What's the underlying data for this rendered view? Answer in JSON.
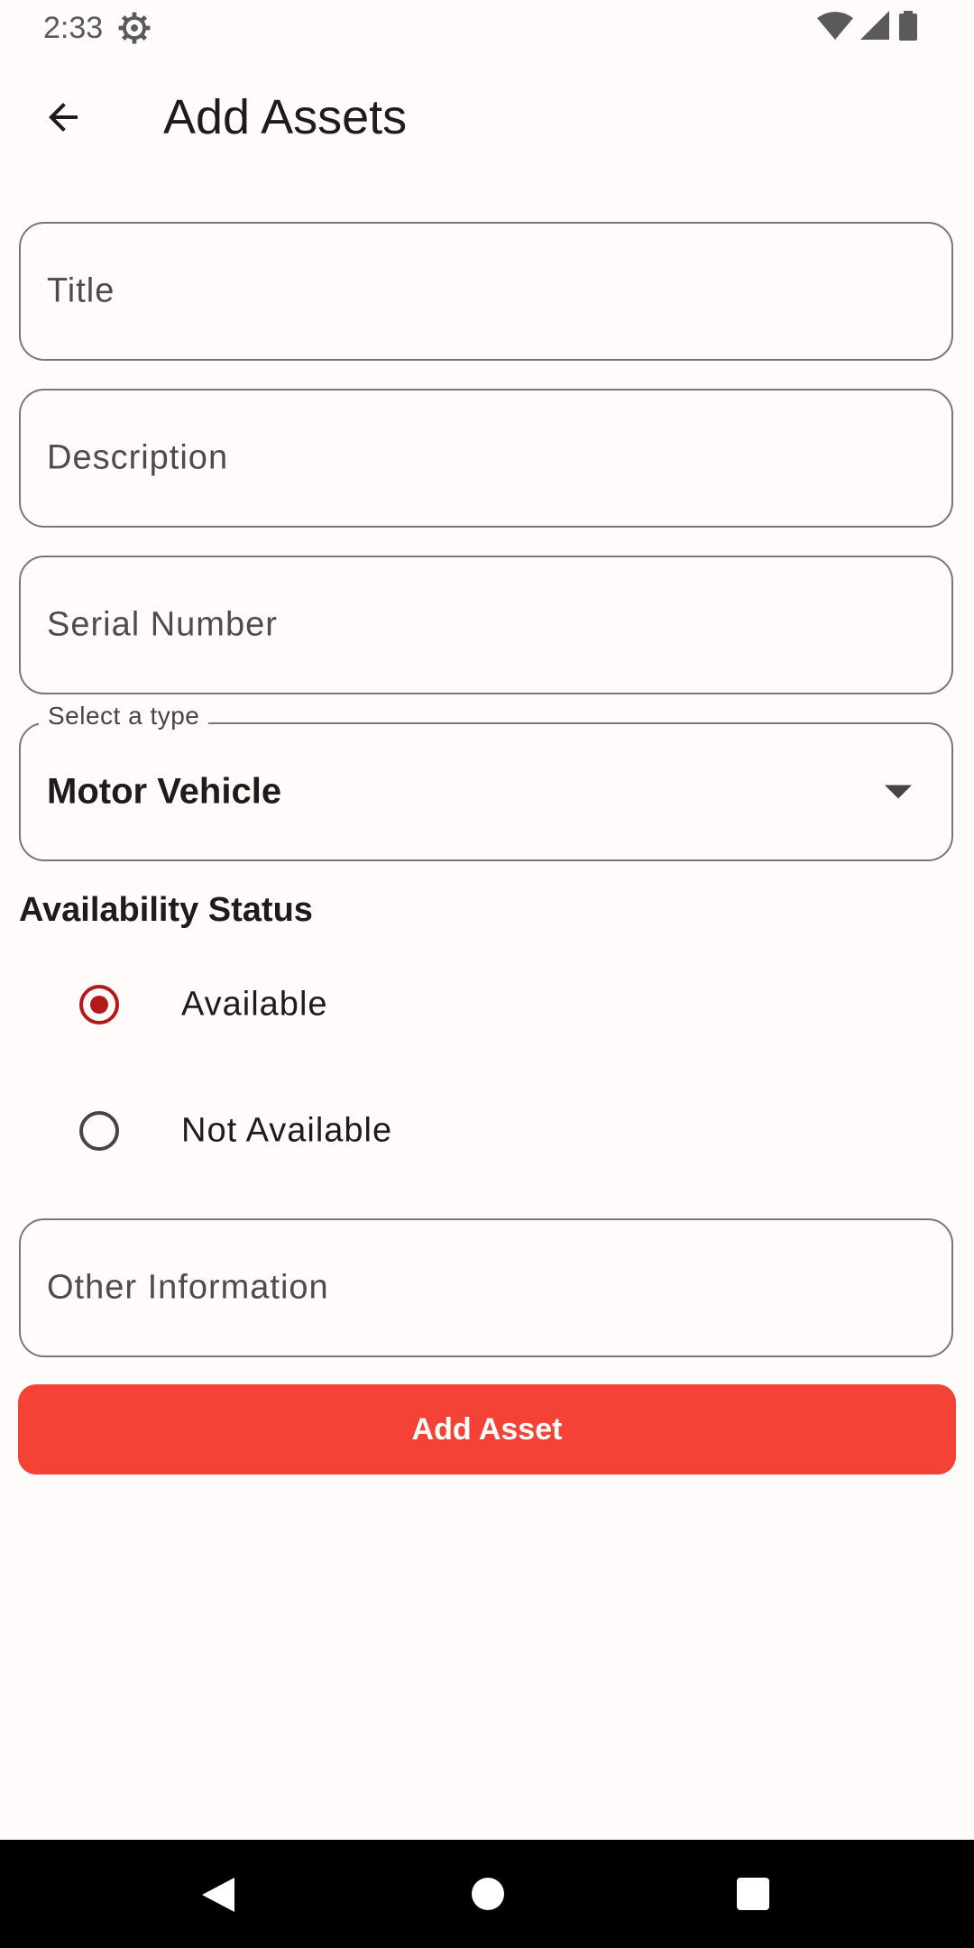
{
  "status_bar": {
    "time": "2:33",
    "icons": [
      "gear-icon",
      "wifi-icon",
      "signal-icon",
      "battery-icon"
    ]
  },
  "app_bar": {
    "back_icon": "arrow-back-icon",
    "title": "Add Assets"
  },
  "form": {
    "title_field": {
      "value": "",
      "placeholder": "Title"
    },
    "description_field": {
      "value": "",
      "placeholder": "Description"
    },
    "serial_field": {
      "value": "",
      "placeholder": "Serial Number"
    },
    "type_select": {
      "label": "Select a type",
      "selected": "Motor Vehicle",
      "arrow_icon": "dropdown-arrow-icon"
    },
    "availability": {
      "heading": "Availability Status",
      "options": [
        {
          "label": "Available",
          "checked": true
        },
        {
          "label": "Not Available",
          "checked": false
        }
      ]
    },
    "other_field": {
      "value": "",
      "placeholder": "Other Information"
    },
    "submit_label": "Add Asset"
  },
  "colors": {
    "background": "#fffbfb",
    "accent": "#f44336",
    "radio_selected": "#b3191a",
    "outline": "#7b7576"
  },
  "nav_bar": {
    "icons": [
      "nav-back-icon",
      "nav-home-icon",
      "nav-recents-icon"
    ]
  }
}
